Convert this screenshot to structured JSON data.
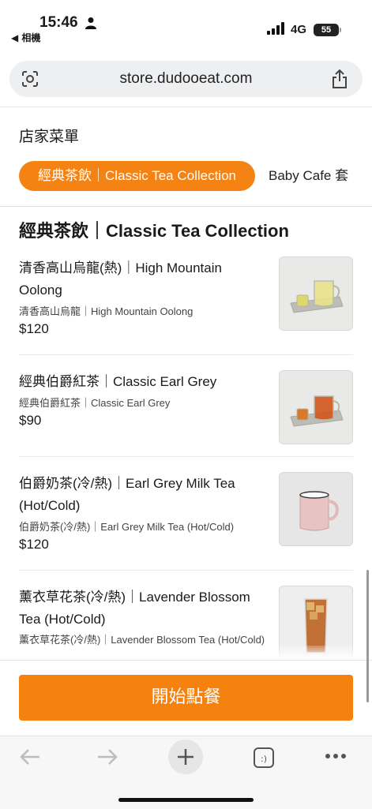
{
  "status_bar": {
    "time": "15:46",
    "back_app": "◀ 相機",
    "network": "4G",
    "battery": "55"
  },
  "browser": {
    "url": "store.dudooeat.com"
  },
  "store": {
    "section_label": "店家菜單",
    "tabs": [
      {
        "label": "經典茶飲｜Classic Tea Collection",
        "active": true
      },
      {
        "label": "Baby Cafe 套",
        "active": false
      }
    ],
    "category_title": "經典茶飲｜Classic Tea Collection",
    "items": [
      {
        "name": "清香高山烏龍(熱)｜High Mountain Oolong",
        "description": "清香高山烏龍｜High Mountain Oolong",
        "price": "$120",
        "image_icon": "oolong-tea-set-icon"
      },
      {
        "name": "經典伯爵紅茶｜Classic Earl Grey",
        "description": "經典伯爵紅茶｜Classic Earl Grey",
        "price": "$90",
        "image_icon": "earl-grey-tea-set-icon"
      },
      {
        "name": "伯爵奶茶(冷/熱)｜Earl Grey Milk Tea (Hot/Cold)",
        "description": "伯爵奶茶(冷/熱)｜Earl Grey Milk Tea (Hot/Cold)",
        "price": "$120",
        "image_icon": "milk-tea-mug-icon"
      },
      {
        "name": "薰衣草花茶(冷/熱)｜Lavender Blossom Tea (Hot/Cold)",
        "description": "薰衣草花茶(冷/熱)｜Lavender Blossom Tea (Hot/Cold)",
        "price": "",
        "image_icon": "iced-tea-glass-icon"
      }
    ],
    "order_button": "開始點餐"
  },
  "colors": {
    "accent": "#f58313",
    "toolbar_bg": "#f7f7f7"
  }
}
